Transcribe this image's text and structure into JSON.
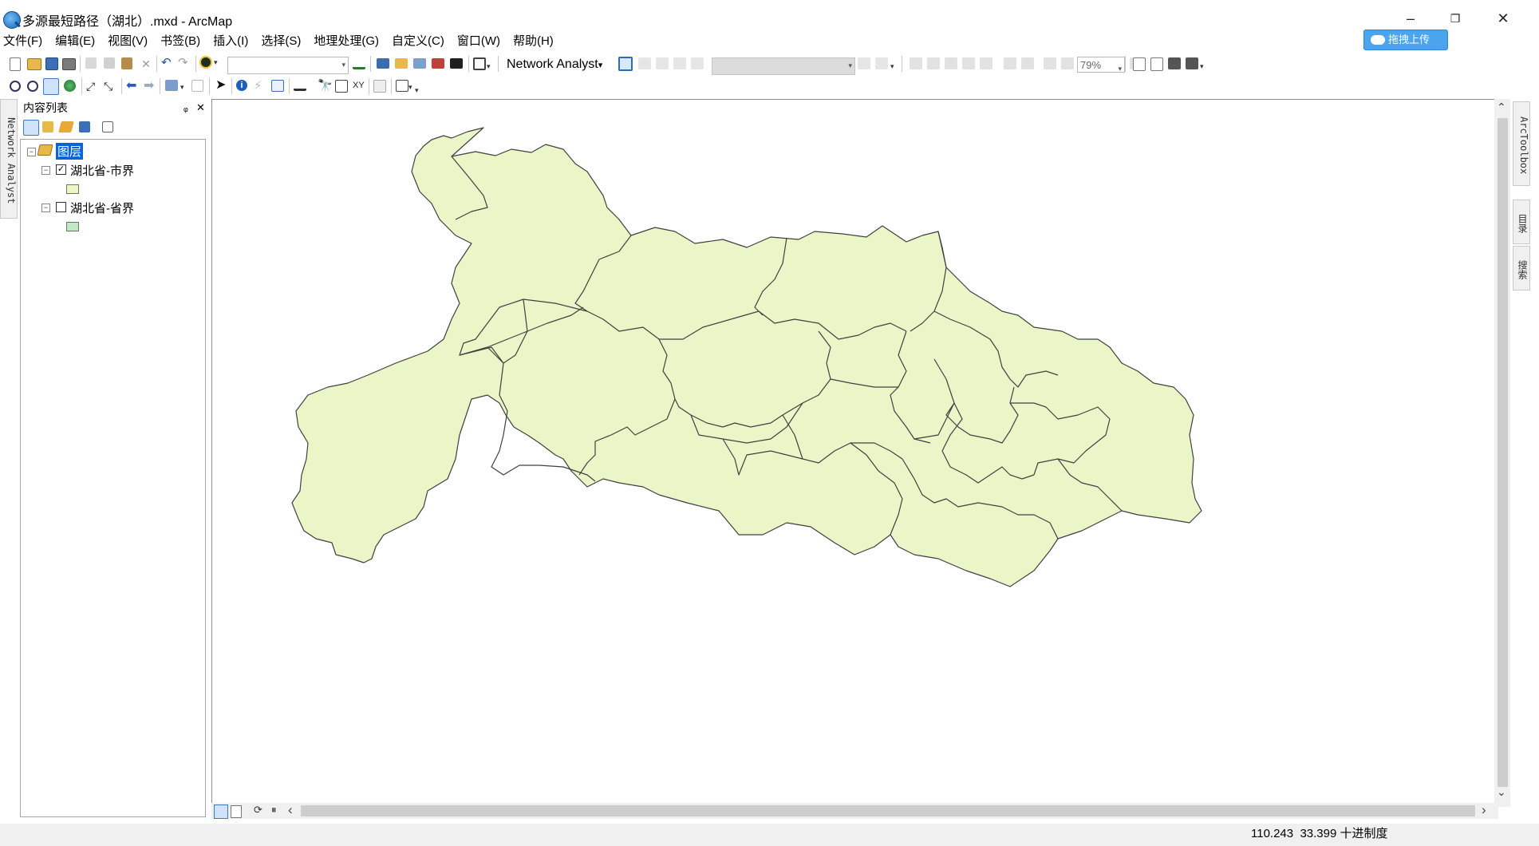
{
  "window": {
    "title": "多源最短路径（湖北）.mxd - ArcMap",
    "minimize": "–",
    "restore": "❐",
    "close": "✕"
  },
  "menu": [
    "文件(F)",
    "编辑(E)",
    "视图(V)",
    "书签(B)",
    "插入(I)",
    "选择(S)",
    "地理处理(G)",
    "自定义(C)",
    "窗口(W)",
    "帮助(H)"
  ],
  "upload_button": "拖拽上传",
  "toolbar": {
    "network_analyst_label": "Network Analyst",
    "network_analyst_arrow": "▾",
    "zoom_level": "79%"
  },
  "toc": {
    "title": "内容列表",
    "pin_icon": "ᵩ",
    "close_icon": "✕",
    "root_label": "图层",
    "layers": [
      {
        "name": "湖北省-市界",
        "checked": true,
        "check_mark": "✓",
        "expander": "−"
      },
      {
        "name": "湖北省-省界",
        "checked": false,
        "check_mark": "",
        "expander": "−"
      }
    ]
  },
  "side_tabs": {
    "left": "Network Analyst",
    "right_top": "ArcToolbox",
    "right_mid": "目录",
    "right_bottom": "搜索"
  },
  "map": {
    "fill_color": "#eaf6c8",
    "outline_color": "#404040"
  },
  "scroll": {
    "left_arrow": "‹",
    "right_arrow": "›",
    "up_arrow": "⌃",
    "down_arrow": "⌄"
  },
  "status": {
    "x": "110.243",
    "y": "33.399",
    "units": "十进制度"
  }
}
